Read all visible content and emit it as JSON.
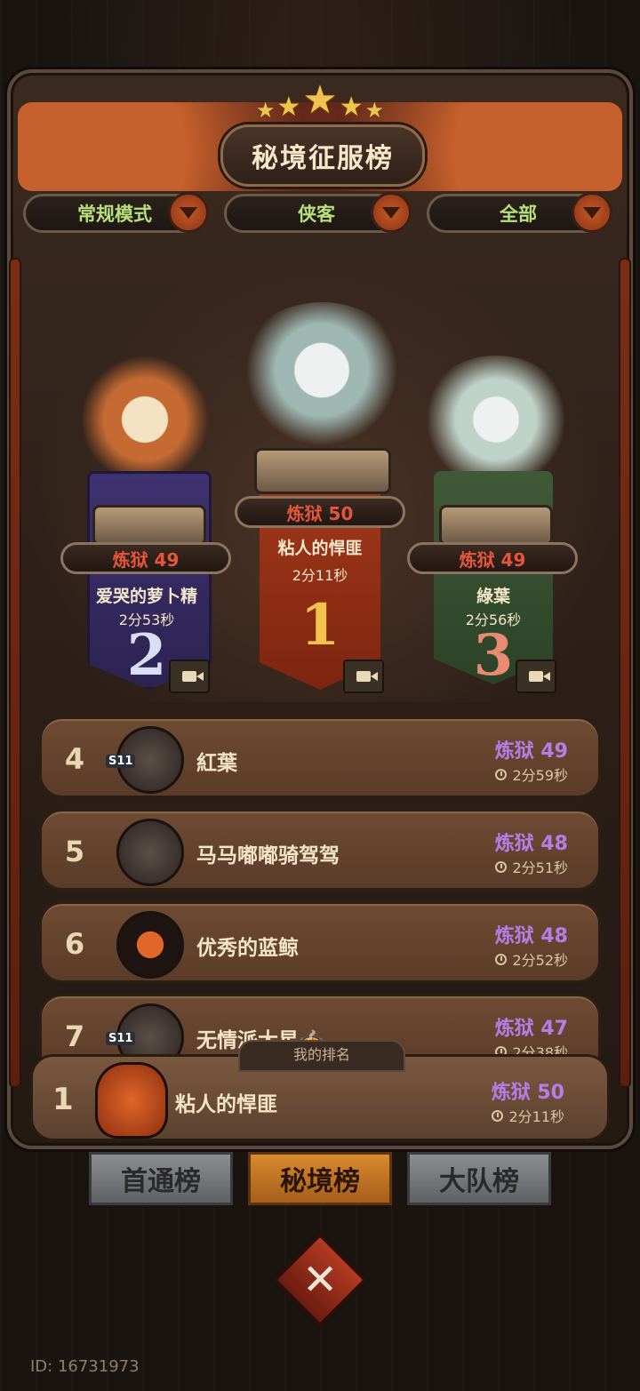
{
  "title": "秘境征服榜",
  "filters": [
    {
      "label": "常规模式"
    },
    {
      "label": "侠客"
    },
    {
      "label": "全部"
    }
  ],
  "podium": {
    "first": {
      "rank": "1",
      "tier": "炼狱 50",
      "name": "粘人的悍匪",
      "time": "2分11秒"
    },
    "second": {
      "rank": "2",
      "tier": "炼狱 49",
      "name": "爱哭的萝卜精",
      "time": "2分53秒"
    },
    "third": {
      "rank": "3",
      "tier": "炼狱 49",
      "name": "綠葉",
      "time": "2分56秒"
    }
  },
  "rows": [
    {
      "rank": "4",
      "name": "紅葉",
      "tier": "炼狱 49",
      "time": "2分59秒",
      "badge": "S11"
    },
    {
      "rank": "5",
      "name": "马马嘟嘟骑驾驾",
      "tier": "炼狱 48",
      "time": "2分51秒"
    },
    {
      "rank": "6",
      "name": "优秀的蓝鲸",
      "tier": "炼狱 48",
      "time": "2分52秒"
    },
    {
      "rank": "7",
      "name": "无情派大星🍲",
      "tier": "炼狱 47",
      "time": "2分38秒",
      "badge": "S11"
    }
  ],
  "my_rank": {
    "label": "我的排名",
    "rank": "1",
    "name": "粘人的悍匪",
    "tier": "炼狱 50",
    "time": "2分11秒"
  },
  "tabs": [
    {
      "label": "首通榜",
      "active": false
    },
    {
      "label": "秘境榜",
      "active": true
    },
    {
      "label": "大队榜",
      "active": false
    }
  ],
  "footer_id": "ID: 16731973",
  "colors": {
    "tier_purple": "#b37ee8",
    "tier_red": "#e4563a",
    "filter_green": "#b6e07a",
    "active_tab": "#d88a2e"
  }
}
